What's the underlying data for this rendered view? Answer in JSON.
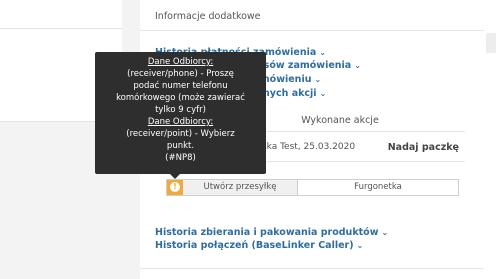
{
  "section": {
    "title": "Informacje dodatkowe"
  },
  "history_links": [
    {
      "label": "Historia płatności zamówienia"
    },
    {
      "label": "Historia zmian statusów zamówienia"
    },
    {
      "label": "Historia zmian w zamówieniu"
    },
    {
      "label": "Historia automatycznych akcji"
    }
  ],
  "actions": {
    "header": "Wykonane akcje",
    "row": {
      "user": "Paczkowska Test, 25.03.2020",
      "action": "Nadaj paczkę"
    }
  },
  "shipment": {
    "warning_icon": "!",
    "create_label": "Utwórz przesyłkę",
    "courier": "Furgonetka"
  },
  "bottom_links": [
    {
      "label": "Historia zbierania i pakowania produktów"
    },
    {
      "label": "Historia połączeń (BaseLinker Caller)"
    }
  ],
  "chevron": "⌄",
  "tooltip": {
    "l1": "Dane Odbiorcy:",
    "l2": "(receiver/phone) -  Proszę",
    "l3": "podać numer telefonu",
    "l4": "komórkowego (może zawierać",
    "l5": "tylko 9 cyfr)",
    "l6": "Dane Odbiorcy:",
    "l7": "(receiver/point) -  Wybierz",
    "l8": "punkt.",
    "l9": "(#NP8)"
  }
}
